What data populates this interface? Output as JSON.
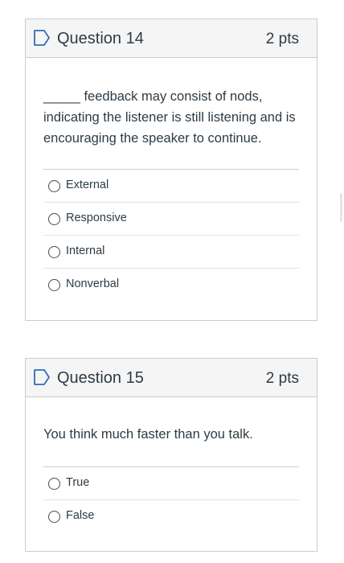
{
  "questions": [
    {
      "title": "Question 14",
      "points": "2 pts",
      "text": "_____ feedback may consist of nods, indicating the listener is still listening and is encouraging the speaker to continue.",
      "answers": [
        "External",
        "Responsive",
        "Internal",
        "Nonverbal"
      ]
    },
    {
      "title": "Question 15",
      "points": "2 pts",
      "text": "You think much faster than you talk.",
      "answers": [
        "True",
        "False"
      ]
    }
  ],
  "icons": {
    "flag": "flag-outline-icon"
  },
  "colors": {
    "flag": "#2d6fb7",
    "border": "#c7cdd1",
    "header_bg": "#f5f5f5"
  }
}
